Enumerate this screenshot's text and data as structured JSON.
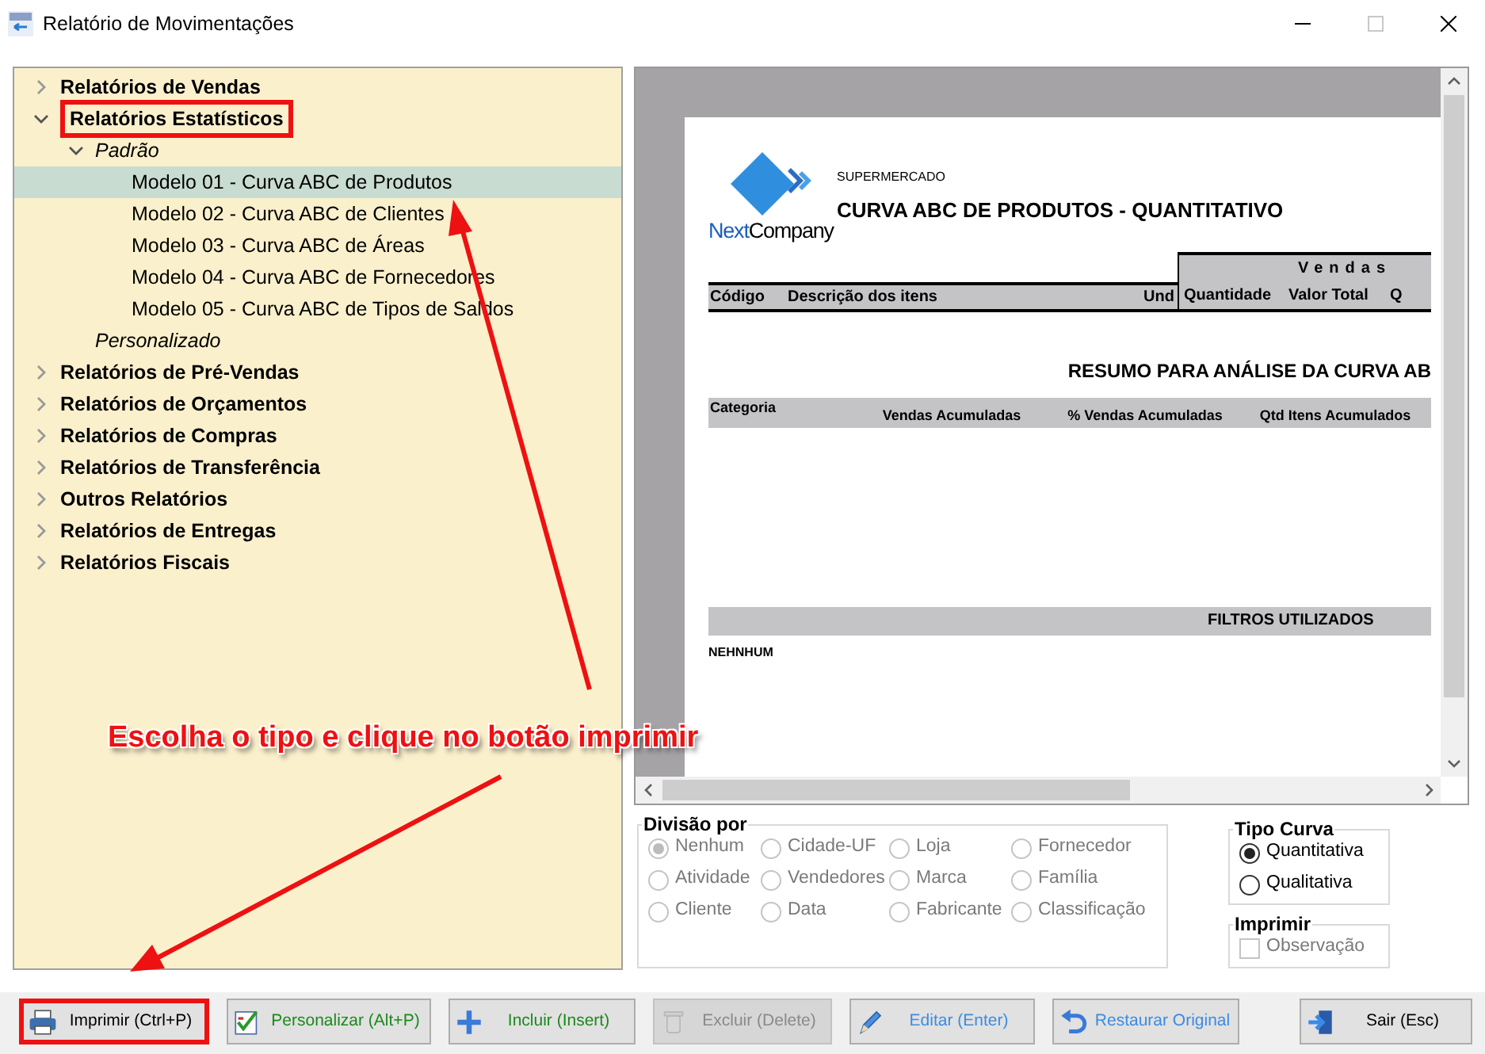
{
  "window": {
    "title": "Relatório de Movimentações",
    "maximize_disabled": true
  },
  "tree": [
    {
      "kind": "category",
      "label": "Relatórios de Vendas",
      "expanded": false,
      "highlighted": false
    },
    {
      "kind": "category",
      "label": "Relatórios Estatísticos",
      "expanded": true,
      "highlighted": true,
      "children": [
        {
          "kind": "group",
          "label": "Padrão",
          "expanded": true,
          "children": [
            {
              "kind": "report",
              "label": "Modelo 01 - Curva ABC de Produtos",
              "selected": true
            },
            {
              "kind": "report",
              "label": "Modelo 02 - Curva ABC de Clientes",
              "selected": false
            },
            {
              "kind": "report",
              "label": "Modelo 03 - Curva ABC de Áreas",
              "selected": false
            },
            {
              "kind": "report",
              "label": "Modelo 04 - Curva ABC de Fornecedores",
              "selected": false
            },
            {
              "kind": "report",
              "label": "Modelo 05 - Curva ABC de Tipos de Saldos",
              "selected": false
            }
          ]
        },
        {
          "kind": "group",
          "label": "Personalizado"
        }
      ]
    },
    {
      "kind": "category",
      "label": "Relatórios de Pré-Vendas",
      "expanded": false,
      "highlighted": false
    },
    {
      "kind": "category",
      "label": "Relatórios de Orçamentos",
      "expanded": false,
      "highlighted": false
    },
    {
      "kind": "category",
      "label": "Relatórios de Compras",
      "expanded": false,
      "highlighted": false
    },
    {
      "kind": "category",
      "label": "Relatórios de Transferência",
      "expanded": false,
      "highlighted": false
    },
    {
      "kind": "category",
      "label": "Outros Relatórios",
      "expanded": false,
      "highlighted": false
    },
    {
      "kind": "category",
      "label": "Relatórios de Entregas",
      "expanded": false,
      "highlighted": false
    },
    {
      "kind": "category",
      "label": "Relatórios Fiscais",
      "expanded": false,
      "highlighted": false
    }
  ],
  "preview": {
    "logo": [
      "Next",
      "Company"
    ],
    "subtitle": "SUPERMERCADO",
    "title": "CURVA ABC DE PRODUTOS - QUANTITATIVO",
    "columns": [
      "Código",
      "Descrição dos itens",
      "Und"
    ],
    "group_header": "Vendas",
    "group_columns": [
      "Quantidade",
      "Valor Total",
      "Q"
    ],
    "summary_title": "RESUMO PARA ANÁLISE DA CURVA AB",
    "summary_columns": [
      "Categoria",
      "Vendas Acumuladas",
      "% Vendas Acumuladas",
      "Qtd Itens Acumulados"
    ],
    "filters_header": "FILTROS UTILIZADOS",
    "filters_value": "NEHNHUM"
  },
  "division": {
    "legend": "Divisão por",
    "disabled": true,
    "options": [
      {
        "label": "Nenhum",
        "selected": true
      },
      {
        "label": "Cidade-UF",
        "selected": false
      },
      {
        "label": "Loja",
        "selected": false
      },
      {
        "label": "Fornecedor",
        "selected": false
      },
      {
        "label": "Atividade",
        "selected": false
      },
      {
        "label": "Vendedores",
        "selected": false
      },
      {
        "label": "Marca",
        "selected": false
      },
      {
        "label": "Família",
        "selected": false
      },
      {
        "label": "Cliente",
        "selected": false
      },
      {
        "label": "Data",
        "selected": false
      },
      {
        "label": "Fabricante",
        "selected": false
      },
      {
        "label": "Classificação",
        "selected": false
      }
    ]
  },
  "curve_type": {
    "legend": "Tipo Curva",
    "disabled": false,
    "options": [
      {
        "label": "Quantitativa",
        "selected": true
      },
      {
        "label": "Qualitativa",
        "selected": false
      }
    ]
  },
  "print_options": {
    "legend": "Imprimir",
    "disabled": true,
    "checkboxes": [
      {
        "label": "Observação",
        "checked": false
      }
    ]
  },
  "buttons": [
    {
      "kind": "print",
      "label": "Imprimir (Ctrl+P)",
      "color": "#000000",
      "disabled": false,
      "highlighted": true
    },
    {
      "kind": "customize",
      "label": "Personalizar (Alt+P)",
      "color": "#1a8a1a",
      "disabled": false,
      "highlighted": false
    },
    {
      "kind": "add",
      "label": "Incluir (Insert)",
      "color": "#1a8a1a",
      "disabled": false,
      "highlighted": false
    },
    {
      "kind": "delete",
      "label": "Excluir (Delete)",
      "color": "#8a8a8a",
      "disabled": true,
      "highlighted": false
    },
    {
      "kind": "edit",
      "label": "Editar (Enter)",
      "color": "#3c8ce0",
      "disabled": false,
      "highlighted": false
    },
    {
      "kind": "restore",
      "label": "Restaurar Original",
      "color": "#3c8ce0",
      "disabled": false,
      "highlighted": false
    },
    {
      "kind": "exit",
      "label": "Sair (Esc)",
      "color": "#000000",
      "disabled": false,
      "highlighted": false
    }
  ],
  "annotation": {
    "text": "Escolha o tipo e clique no botão imprimir"
  }
}
